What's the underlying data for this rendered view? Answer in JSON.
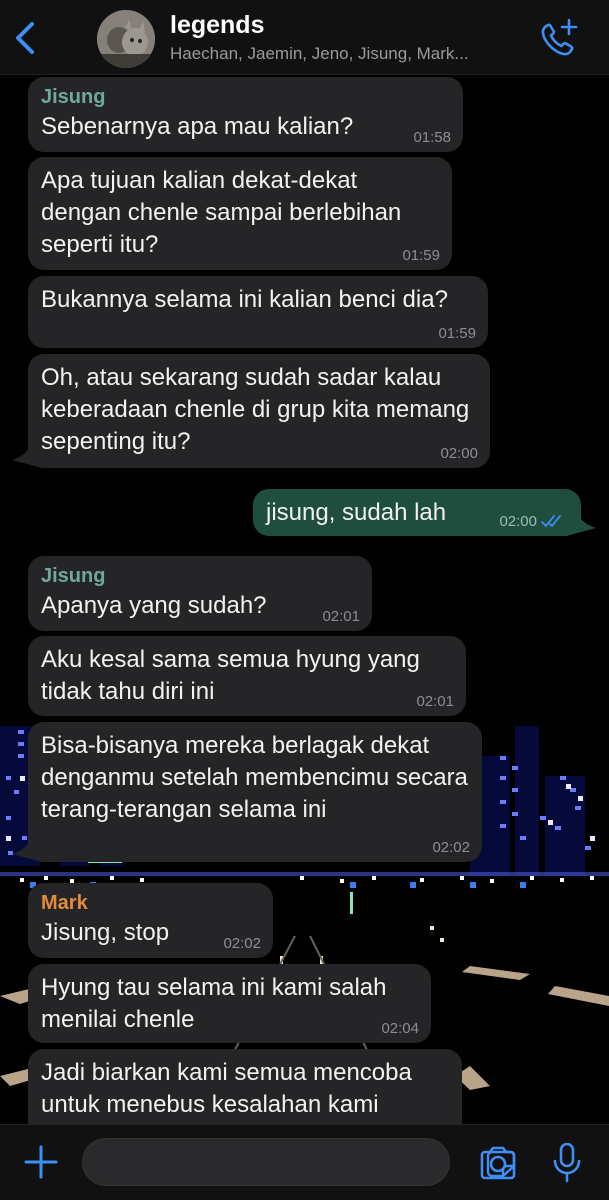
{
  "header": {
    "title": "legends",
    "members": "Haechan, Jaemin, Jeno, Jisung, Mark..."
  },
  "messages": [
    {
      "sender": "Jisung",
      "text": "Sebenarnya apa mau kalian?",
      "time": "01:58"
    },
    {
      "text": "Apa tujuan kalian dekat-dekat dengan chenle sampai berlebihan seperti itu?",
      "time": "01:59"
    },
    {
      "text": "Bukannya selama ini kalian benci dia?",
      "time": "01:59"
    },
    {
      "text": "Oh, atau sekarang sudah sadar kalau keberadaan chenle di grup kita memang sepenting itu?",
      "time": "02:00"
    },
    {
      "text": "jisung, sudah lah",
      "time": "02:00",
      "status": "read"
    },
    {
      "sender": "Jisung",
      "text": "Apanya yang sudah?",
      "time": "02:01"
    },
    {
      "text": "Aku kesal sama semua hyung yang tidak tahu diri ini",
      "time": "02:01"
    },
    {
      "text": "Bisa-bisanya mereka berlagak dekat denganmu setelah membencimu secara terang-terangan selama ini",
      "time": "02:02"
    },
    {
      "sender": "Mark",
      "text": "Jisung, stop",
      "time": "02:02"
    },
    {
      "text": "Hyung tau selama ini kami salah menilai chenle",
      "time": "02:04"
    },
    {
      "text": "Jadi biarkan kami semua mencoba untuk menebus kesalahan kami",
      "time": ""
    }
  ],
  "colors": {
    "incoming_bubble": "#252527",
    "outgoing_bubble": "#1f4e3f",
    "accent_blue": "#3d8ff5",
    "sender_jisung": "#6fa89d",
    "sender_mark": "#e38b3b"
  },
  "icons": {
    "back": "chevron-left-icon",
    "call": "phone-plus-icon",
    "add": "plus-icon",
    "sticker": "sticker-icon",
    "camera": "camera-icon",
    "mic": "microphone-icon"
  }
}
